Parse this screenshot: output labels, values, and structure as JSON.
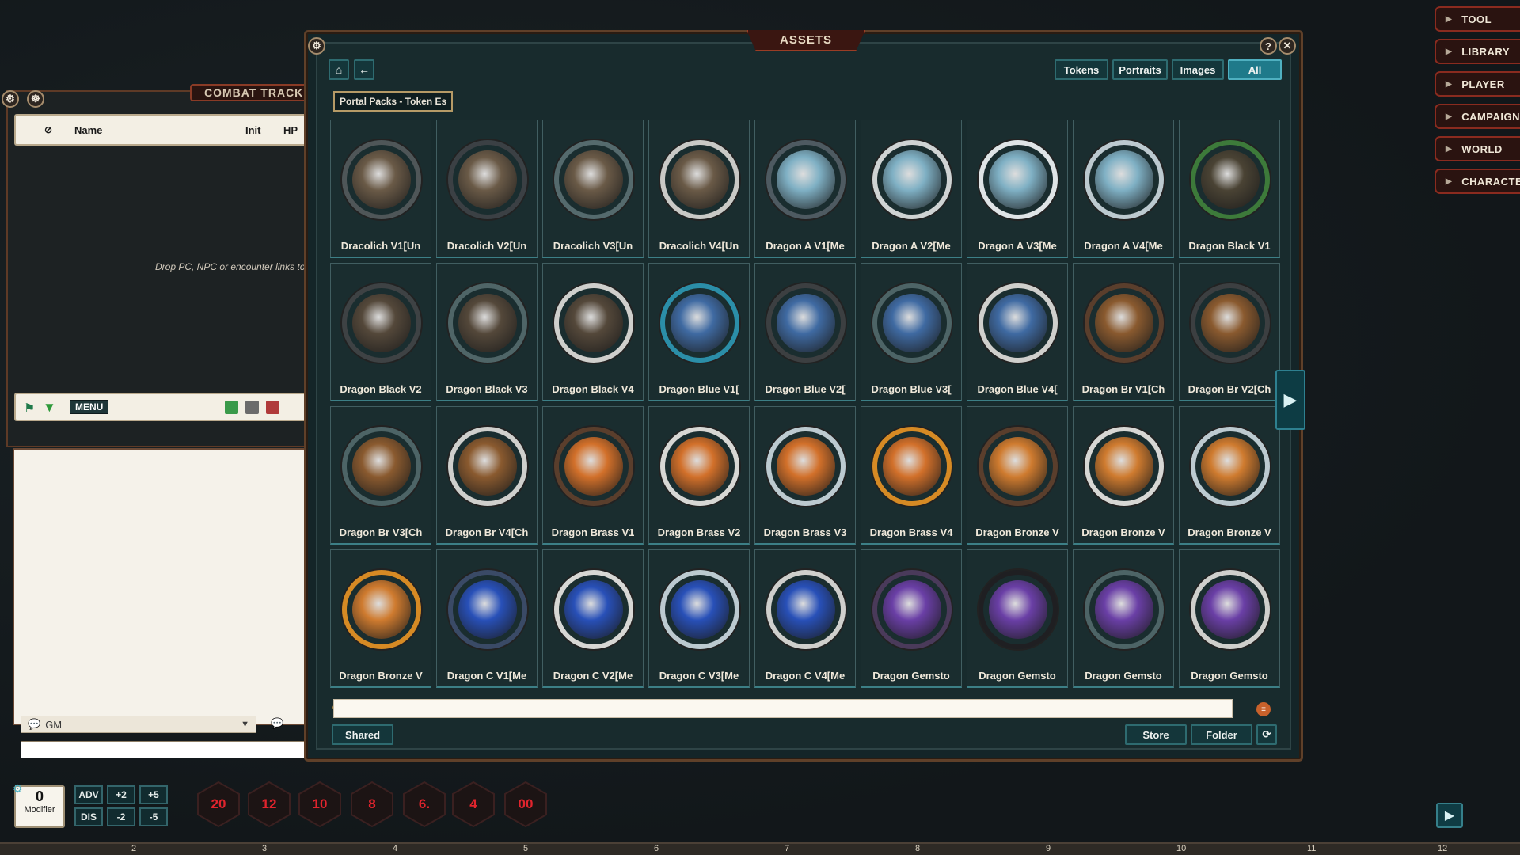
{
  "sidebar": {
    "items": [
      {
        "label": "TOOL"
      },
      {
        "label": "LIBRARY"
      },
      {
        "label": "PLAYER"
      },
      {
        "label": "CAMPAIGN"
      },
      {
        "label": "WORLD"
      },
      {
        "label": "CHARACTER"
      }
    ]
  },
  "combat": {
    "title": "COMBAT TRACKER",
    "columns": {
      "name": "Name",
      "init": "Init",
      "hp": "HP"
    },
    "drop_text": "Drop PC, NPC or encounter links to",
    "menu_label": "MENU"
  },
  "chat": {
    "identity": "GM"
  },
  "assets": {
    "title": "ASSETS",
    "filters": [
      {
        "label": "Tokens",
        "active": false
      },
      {
        "label": "Portraits",
        "active": false
      },
      {
        "label": "Images",
        "active": false
      },
      {
        "label": "All",
        "active": true
      }
    ],
    "breadcrumb": "Portal Packs - Token Es",
    "tiles": [
      {
        "label": "Dracolich V1[Un",
        "ring": "#4f5658",
        "core": "#6a5a47"
      },
      {
        "label": "Dracolich V2[Un",
        "ring": "#3b4044",
        "core": "#6a5a47"
      },
      {
        "label": "Dracolich V3[Un",
        "ring": "#556a6d",
        "core": "#6a5a47"
      },
      {
        "label": "Dracolich V4[Un",
        "ring": "#c9c9c6",
        "core": "#6a5a47"
      },
      {
        "label": "Dragon A V1[Me",
        "ring": "#4e5a61",
        "core": "#7fb0c4"
      },
      {
        "label": "Dragon A V2[Me",
        "ring": "#cfd3d3",
        "core": "#7fb0c4"
      },
      {
        "label": "Dragon A V3[Me",
        "ring": "#dfe4e6",
        "core": "#7fb0c4"
      },
      {
        "label": "Dragon A V4[Me",
        "ring": "#bcc9cf",
        "core": "#7fb0c4"
      },
      {
        "label": "Dragon Black V1",
        "ring": "#3d7a3a",
        "core": "#4a4334"
      },
      {
        "label": "Dragon Black V2",
        "ring": "#3e4244",
        "core": "#54483a"
      },
      {
        "label": "Dragon Black V3",
        "ring": "#4f6567",
        "core": "#54483a"
      },
      {
        "label": "Dragon Black V4",
        "ring": "#cfcfcc",
        "core": "#54483a"
      },
      {
        "label": "Dragon Blue V1[",
        "ring": "#2b8ea8",
        "core": "#3f6aa2"
      },
      {
        "label": "Dragon Blue V2[",
        "ring": "#3c3f41",
        "core": "#3f6aa2"
      },
      {
        "label": "Dragon Blue V3[",
        "ring": "#4d6466",
        "core": "#3f6aa2"
      },
      {
        "label": "Dragon Blue V4[",
        "ring": "#cfcfcc",
        "core": "#3f6aa2"
      },
      {
        "label": "Dragon Br V1[Ch",
        "ring": "#5a3e2c",
        "core": "#8a5a2f"
      },
      {
        "label": "Dragon Br V2[Ch",
        "ring": "#3c3f41",
        "core": "#8a5a2f"
      },
      {
        "label": "Dragon Br V3[Ch",
        "ring": "#4d6466",
        "core": "#8a5a2f"
      },
      {
        "label": "Dragon Br V4[Ch",
        "ring": "#cfcfcc",
        "core": "#8a5a2f"
      },
      {
        "label": "Dragon Brass V1",
        "ring": "#5a3e2c",
        "core": "#d2702a"
      },
      {
        "label": "Dragon Brass V2",
        "ring": "#d7d7d4",
        "core": "#d2702a"
      },
      {
        "label": "Dragon Brass V3",
        "ring": "#bccad0",
        "core": "#d2702a"
      },
      {
        "label": "Dragon Brass V4",
        "ring": "#d68a24",
        "core": "#d2702a"
      },
      {
        "label": "Dragon Bronze V",
        "ring": "#5a3e2c",
        "core": "#cf7b2f"
      },
      {
        "label": "Dragon Bronze V",
        "ring": "#d7d7d4",
        "core": "#cf7b2f"
      },
      {
        "label": "Dragon Bronze V",
        "ring": "#bccad0",
        "core": "#cf7b2f"
      },
      {
        "label": "Dragon Bronze V",
        "ring": "#d68a24",
        "core": "#cf7b2f"
      },
      {
        "label": "Dragon C V1[Me",
        "ring": "#3a4a66",
        "core": "#2850b8"
      },
      {
        "label": "Dragon C V2[Me",
        "ring": "#d7d7d4",
        "core": "#2850b8"
      },
      {
        "label": "Dragon C V3[Me",
        "ring": "#bccad0",
        "core": "#2850b8"
      },
      {
        "label": "Dragon C V4[Me",
        "ring": "#cfcfcc",
        "core": "#2850b8"
      },
      {
        "label": "Dragon Gemsto",
        "ring": "#4a3a5a",
        "core": "#6a3fa6"
      },
      {
        "label": "Dragon Gemsto",
        "ring": "#1f1f22",
        "core": "#6a3fa6"
      },
      {
        "label": "Dragon Gemsto",
        "ring": "#4d6466",
        "core": "#6a3fa6"
      },
      {
        "label": "Dragon Gemsto",
        "ring": "#cfcfcc",
        "core": "#6a3fa6"
      }
    ],
    "search_value": "",
    "shared_label": "Shared",
    "store_label": "Store",
    "folder_label": "Folder"
  },
  "bottom": {
    "modifier_value": "0",
    "modifier_label": "Modifier",
    "adv": "ADV",
    "dis": "DIS",
    "plus2": "+2",
    "plus5": "+5",
    "minus2": "-2",
    "minus5": "-5",
    "dice": [
      "20",
      "12",
      "10",
      "8",
      "6.",
      "4",
      "00"
    ],
    "ruler": [
      "2",
      "3",
      "4",
      "5",
      "6",
      "7",
      "8",
      "9",
      "10",
      "11",
      "12"
    ]
  },
  "colors": {
    "accent_teal": "#1f7a8a",
    "brand_red": "#8a2b1f",
    "die_red": "#e0242d"
  }
}
